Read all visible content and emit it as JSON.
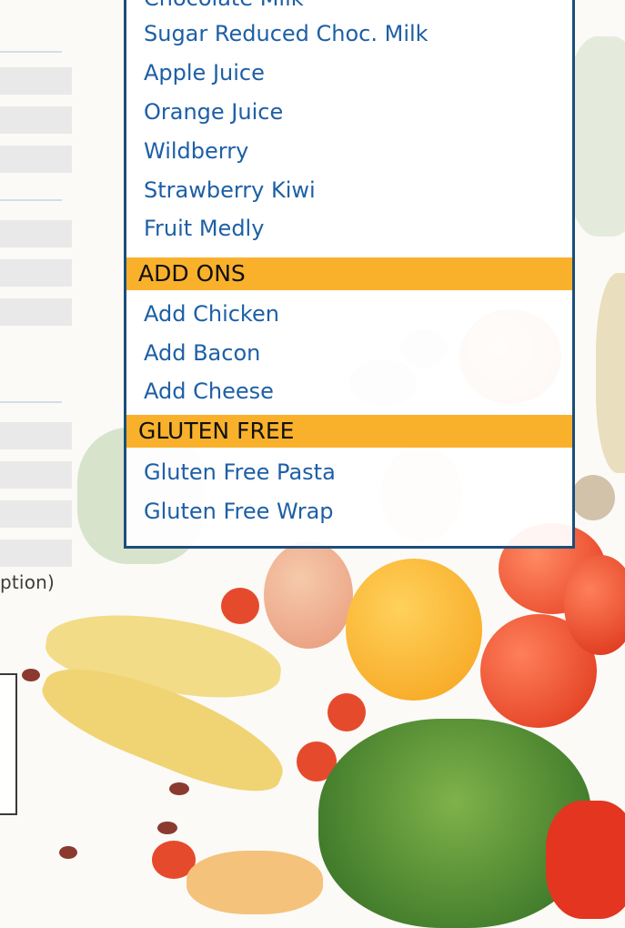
{
  "menu": {
    "top_partial": "Chocolate Milk",
    "drinks": [
      "Sugar Reduced Choc. Milk",
      "Apple Juice",
      "Orange Juice",
      "Wildberry",
      "Strawberry Kiwi",
      "Fruit Medly"
    ],
    "add_ons_header": "ADD ONS",
    "add_ons": [
      "Add Chicken",
      "Add Bacon",
      "Add Cheese"
    ],
    "gluten_free_header": "GLUTEN FREE",
    "gluten_free": [
      "Gluten Free Pasta",
      "Gluten Free Wrap"
    ]
  },
  "form": {
    "option_note": "ption)"
  },
  "colors": {
    "panel_border": "#1d4e7a",
    "item_text": "#1d5fa6",
    "header_bg": "#f9b12c"
  }
}
